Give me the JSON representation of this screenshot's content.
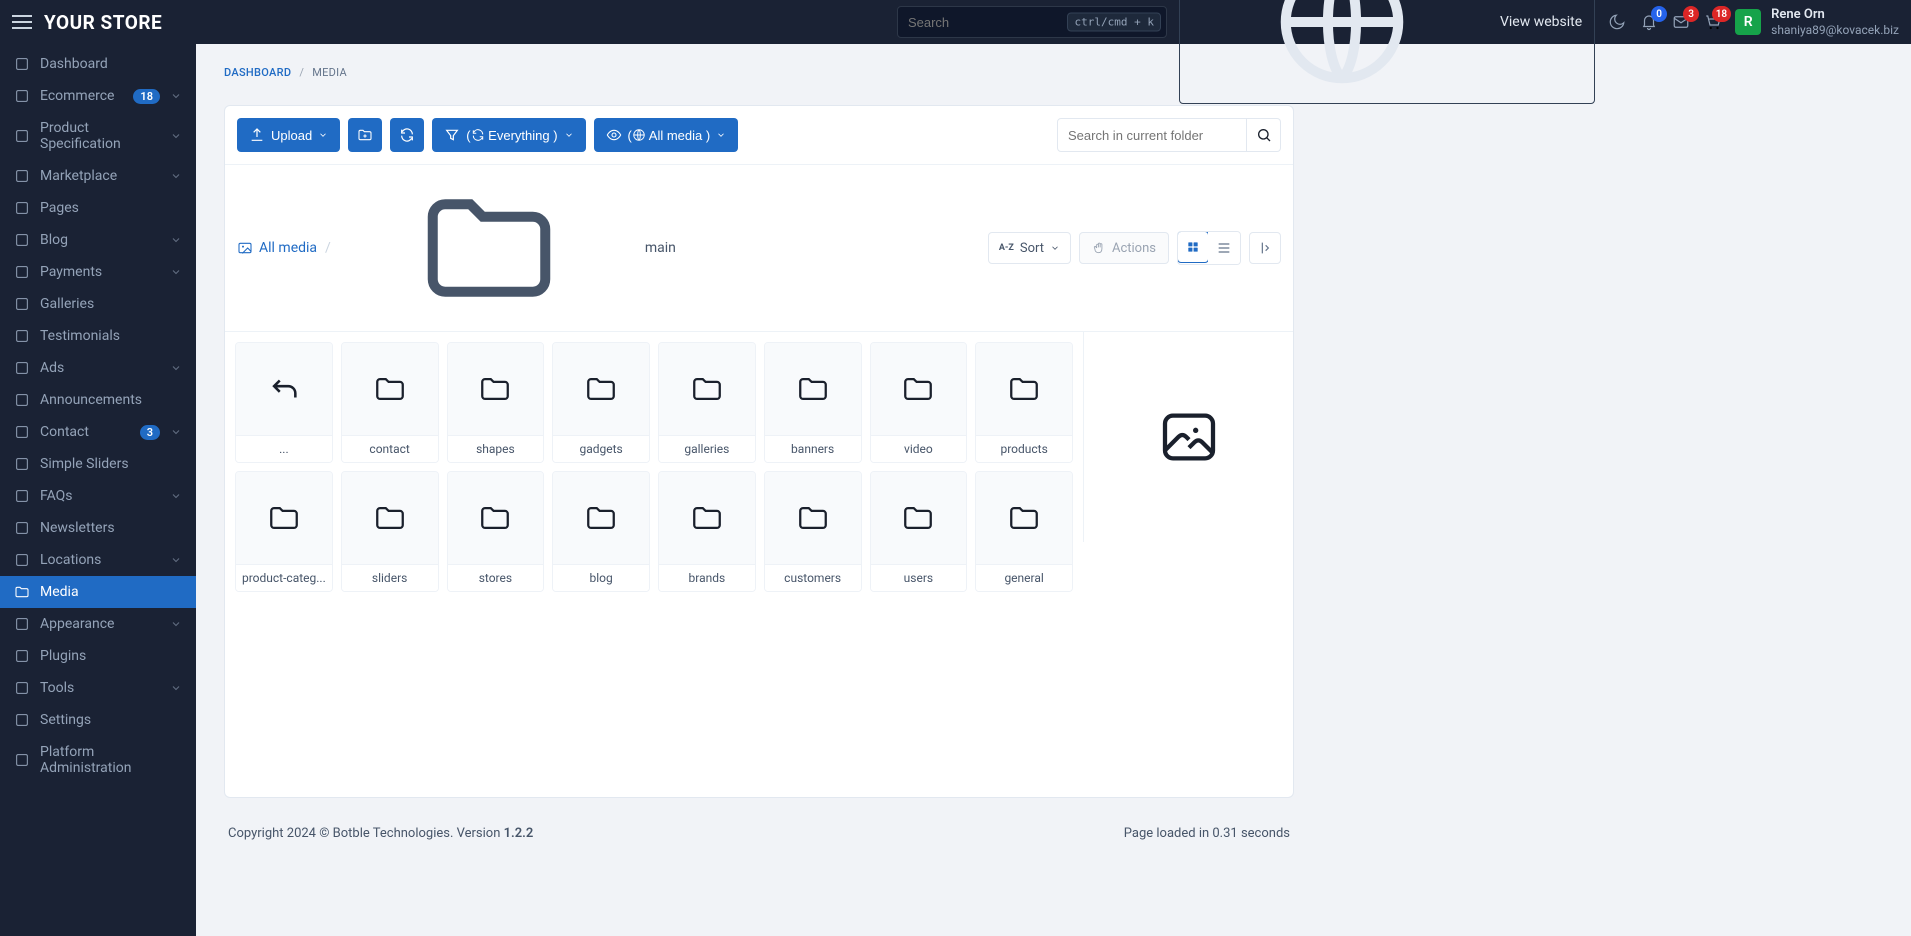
{
  "header": {
    "logo": "YOUR STORE",
    "searchPlaceholder": "Search",
    "kbd": "ctrl/cmd + k",
    "viewWebsite": "View website",
    "badges": {
      "bell": "0",
      "mail": "3",
      "cart": "18"
    },
    "avatarLetter": "R",
    "userName": "Rene Orn",
    "userEmail": "shaniya89@kovacek.biz"
  },
  "sidebar": [
    {
      "label": "Dashboard",
      "icon": "home"
    },
    {
      "label": "Ecommerce",
      "icon": "bag",
      "badge": "18",
      "expandable": true
    },
    {
      "label": "Product Specification",
      "icon": "layout",
      "expandable": true
    },
    {
      "label": "Marketplace",
      "icon": "store",
      "expandable": true
    },
    {
      "label": "Pages",
      "icon": "file"
    },
    {
      "label": "Blog",
      "icon": "doc",
      "expandable": true
    },
    {
      "label": "Payments",
      "icon": "card",
      "expandable": true
    },
    {
      "label": "Galleries",
      "icon": "camera"
    },
    {
      "label": "Testimonials",
      "icon": "users"
    },
    {
      "label": "Ads",
      "icon": "target",
      "expandable": true
    },
    {
      "label": "Announcements",
      "icon": "speaker"
    },
    {
      "label": "Contact",
      "icon": "mail",
      "badge": "3",
      "expandable": true
    },
    {
      "label": "Simple Sliders",
      "icon": "sliders"
    },
    {
      "label": "FAQs",
      "icon": "help",
      "expandable": true
    },
    {
      "label": "Newsletters",
      "icon": "news"
    },
    {
      "label": "Locations",
      "icon": "globe",
      "expandable": true
    },
    {
      "label": "Media",
      "icon": "folder",
      "active": true
    },
    {
      "label": "Appearance",
      "icon": "rocket",
      "expandable": true
    },
    {
      "label": "Plugins",
      "icon": "plug"
    },
    {
      "label": "Tools",
      "icon": "spanner",
      "expandable": true
    },
    {
      "label": "Settings",
      "icon": "gear"
    },
    {
      "label": "Platform Administration",
      "icon": "user"
    }
  ],
  "breadcrumb": {
    "root": "DASHBOARD",
    "current": "MEDIA"
  },
  "toolbar": {
    "upload": "Upload",
    "filterLabel": "Everything",
    "viewLabel": "All media",
    "searchPlaceholder": "Search in current folder"
  },
  "subbar": {
    "allMedia": "All media",
    "current": "main",
    "sort": "Sort",
    "actions": "Actions"
  },
  "folders": [
    {
      "name": "...",
      "back": true
    },
    {
      "name": "contact"
    },
    {
      "name": "shapes"
    },
    {
      "name": "gadgets"
    },
    {
      "name": "galleries"
    },
    {
      "name": "banners"
    },
    {
      "name": "video"
    },
    {
      "name": "products"
    },
    {
      "name": "product-categ..."
    },
    {
      "name": "sliders"
    },
    {
      "name": "stores"
    },
    {
      "name": "blog"
    },
    {
      "name": "brands"
    },
    {
      "name": "customers"
    },
    {
      "name": "users"
    },
    {
      "name": "general"
    }
  ],
  "footer": {
    "left1": "Copyright 2024 © Botble Technologies. Version ",
    "version": "1.2.2",
    "right": "Page loaded in 0.31 seconds"
  }
}
